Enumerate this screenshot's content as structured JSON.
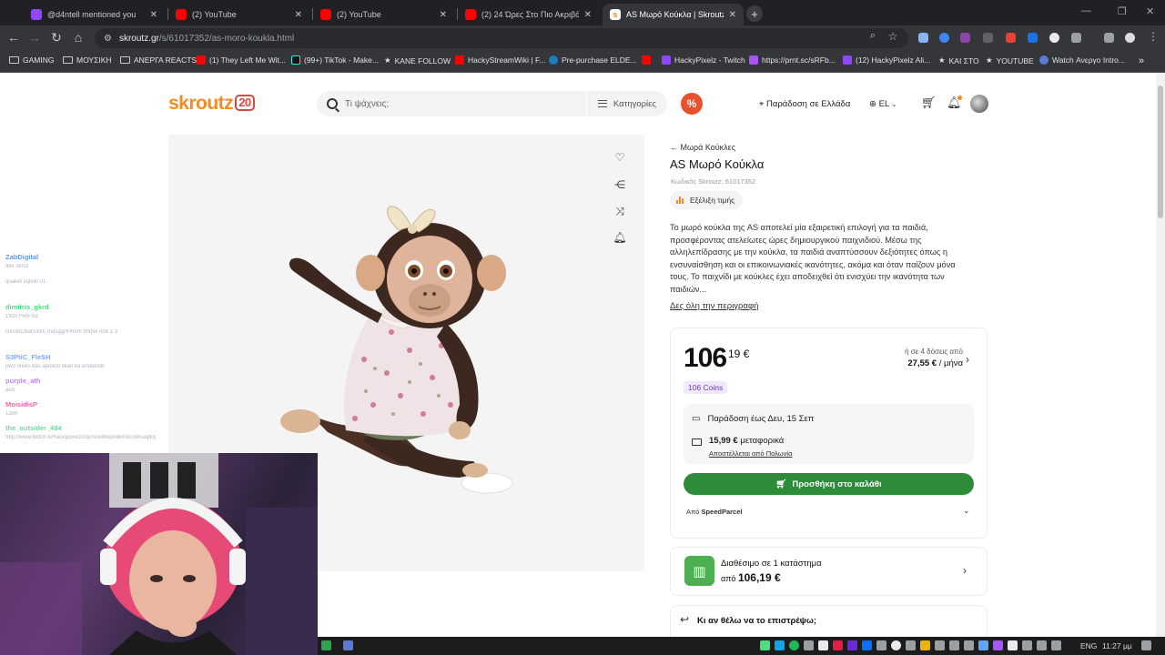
{
  "browser": {
    "tabs": [
      {
        "title": "@d4ntell mentioned you",
        "color": "#9146ff"
      },
      {
        "title": "(2) YouTube",
        "color": "#ff0000"
      },
      {
        "title": "(2) YouTube",
        "color": "#ff0000"
      },
      {
        "title": "(2) 24 Ώρες Στο Πιο Ακριβό Ν...",
        "color": "#ff0000"
      },
      {
        "title": "AS Μωρό Κούκλα | Skroutz.gr",
        "color": "#f68b24"
      }
    ],
    "url_domain": "skroutz.gr",
    "url_path": "/s/61017352/as-moro-koukla.html",
    "bookmarks": [
      {
        "label": "GAMING",
        "type": "folder"
      },
      {
        "label": "ΜΟΥΣΙΚΗ",
        "type": "folder"
      },
      {
        "label": "ΑΝΕΡΓΑ REACTS",
        "type": "folder"
      },
      {
        "label": "(1) They Left Me Wit...",
        "type": "youtube"
      },
      {
        "label": "(99+) TikTok - Make...",
        "type": "tiktok"
      },
      {
        "label": "KANE FOLLOW",
        "type": "star"
      },
      {
        "label": "HackyStreamWiki | F...",
        "type": "youtube"
      },
      {
        "label": "Pre-purchase ELDE...",
        "type": "steam"
      },
      {
        "label": "",
        "type": "youtube"
      },
      {
        "label": "HackyPixelz - Twitch",
        "type": "twitch"
      },
      {
        "label": "https://prnt.sc/sRFb...",
        "type": "feather"
      },
      {
        "label": "(12) HackyPixelz Ali...",
        "type": "twitch"
      },
      {
        "label": "ΚΑΙ ΣΤΟ",
        "type": "star"
      },
      {
        "label": "YOUTUBE",
        "type": "star"
      },
      {
        "label": "Watch Ανεργο Intro...",
        "type": "go"
      }
    ]
  },
  "site": {
    "search_placeholder": "Τι ψάχνεις;",
    "categories": "Κατηγορίες",
    "delivery": "Παράδοση σε Ελλάδα",
    "lang": "EL",
    "logo": "skroutz",
    "logo_badge": "20"
  },
  "product": {
    "breadcrumb": "Μωρά Κούκλες",
    "title": "AS Μωρό Κούκλα",
    "code": "Κωδικός Skroutz: 61017352",
    "price_history": "Εξέλιξη τιμής",
    "description": "Το μωρό κούκλα της AS αποτελεί μία εξαιρετική επιλογή για τα παιδιά, προσφέροντας ατελείωτες ώρες δημιουργικού παιχνιδιού. Μέσω της αλληλεπίδρασης με την κούκλα, τα παιδιά αναπτύσσουν δεξιότητες όπως η ενσυναίσθηση και οι επικοινωνιακές ικανότητες, ακόμα και όταν παίζουν μόνα τους. Το παιχνίδι με κούκλες έχει αποδειχθεί ότι ενισχύει την ικανότητα των παιδιών...",
    "see_more": "Δες όλη την περιγραφή",
    "price_int": "106",
    "price_dec": "19 €",
    "installments_line1": "ή σε 4 δόσεις από",
    "installments_amount": "27,55 €",
    "installments_unit": "/ μήνα",
    "coins": "106 Coins",
    "delivery_date": "Παράδοση έως Δευ, 15 Σεπ",
    "shipping_cost": "15,99 €",
    "shipping_label": "μεταφορικά",
    "ships_from": "Αποστέλλεται από Πολωνία",
    "add_to_cart": "Προσθήκη στο καλάθι",
    "seller_prefix": "Από",
    "seller_name": "SpeedParcel",
    "store_line1": "Διαθέσιμο σε 1 κατάστημα",
    "store_prefix": "από",
    "store_price": "106,19 €",
    "return_question": "Κι αν θέλω να το επιστρέψω;"
  },
  "chat": [
    {
      "user": "ZabDigital",
      "color": "#5b9bff",
      "text": "dex skroz"
    },
    {
      "user": "",
      "color": "#aeb2c0",
      "text": "quaket    sqlxiki 01"
    },
    {
      "user": "dimitris_gkrd",
      "color": "#4ade80",
      "text": "1920 FAN tss"
    },
    {
      "user": "",
      "color": "#aeb2c0",
      "text": "DerdoCBaroXkE   mqsggPPhnm bnrjsk nob 1 3"
    },
    {
      "user": "S3PtiC_FleSH",
      "color": "#7ea8ff",
      "text": "pwo nrkes 8as apotelo xkan ka endaklob"
    },
    {
      "user": "purple_ath",
      "color": "#c084fc",
      "text": "aud"
    },
    {
      "user": "MoisidisP",
      "color": "#ff5fa2",
      "text": "1300"
    },
    {
      "user": "the_outsider_404",
      "color": "#7dd3a8",
      "text": "http://www.twitch.tv/hackypixelz/clip/sredhupmlkms0oWsaqfkq"
    }
  ],
  "taskbar": {
    "lang": "ENG",
    "time": "11:27 μμ"
  }
}
